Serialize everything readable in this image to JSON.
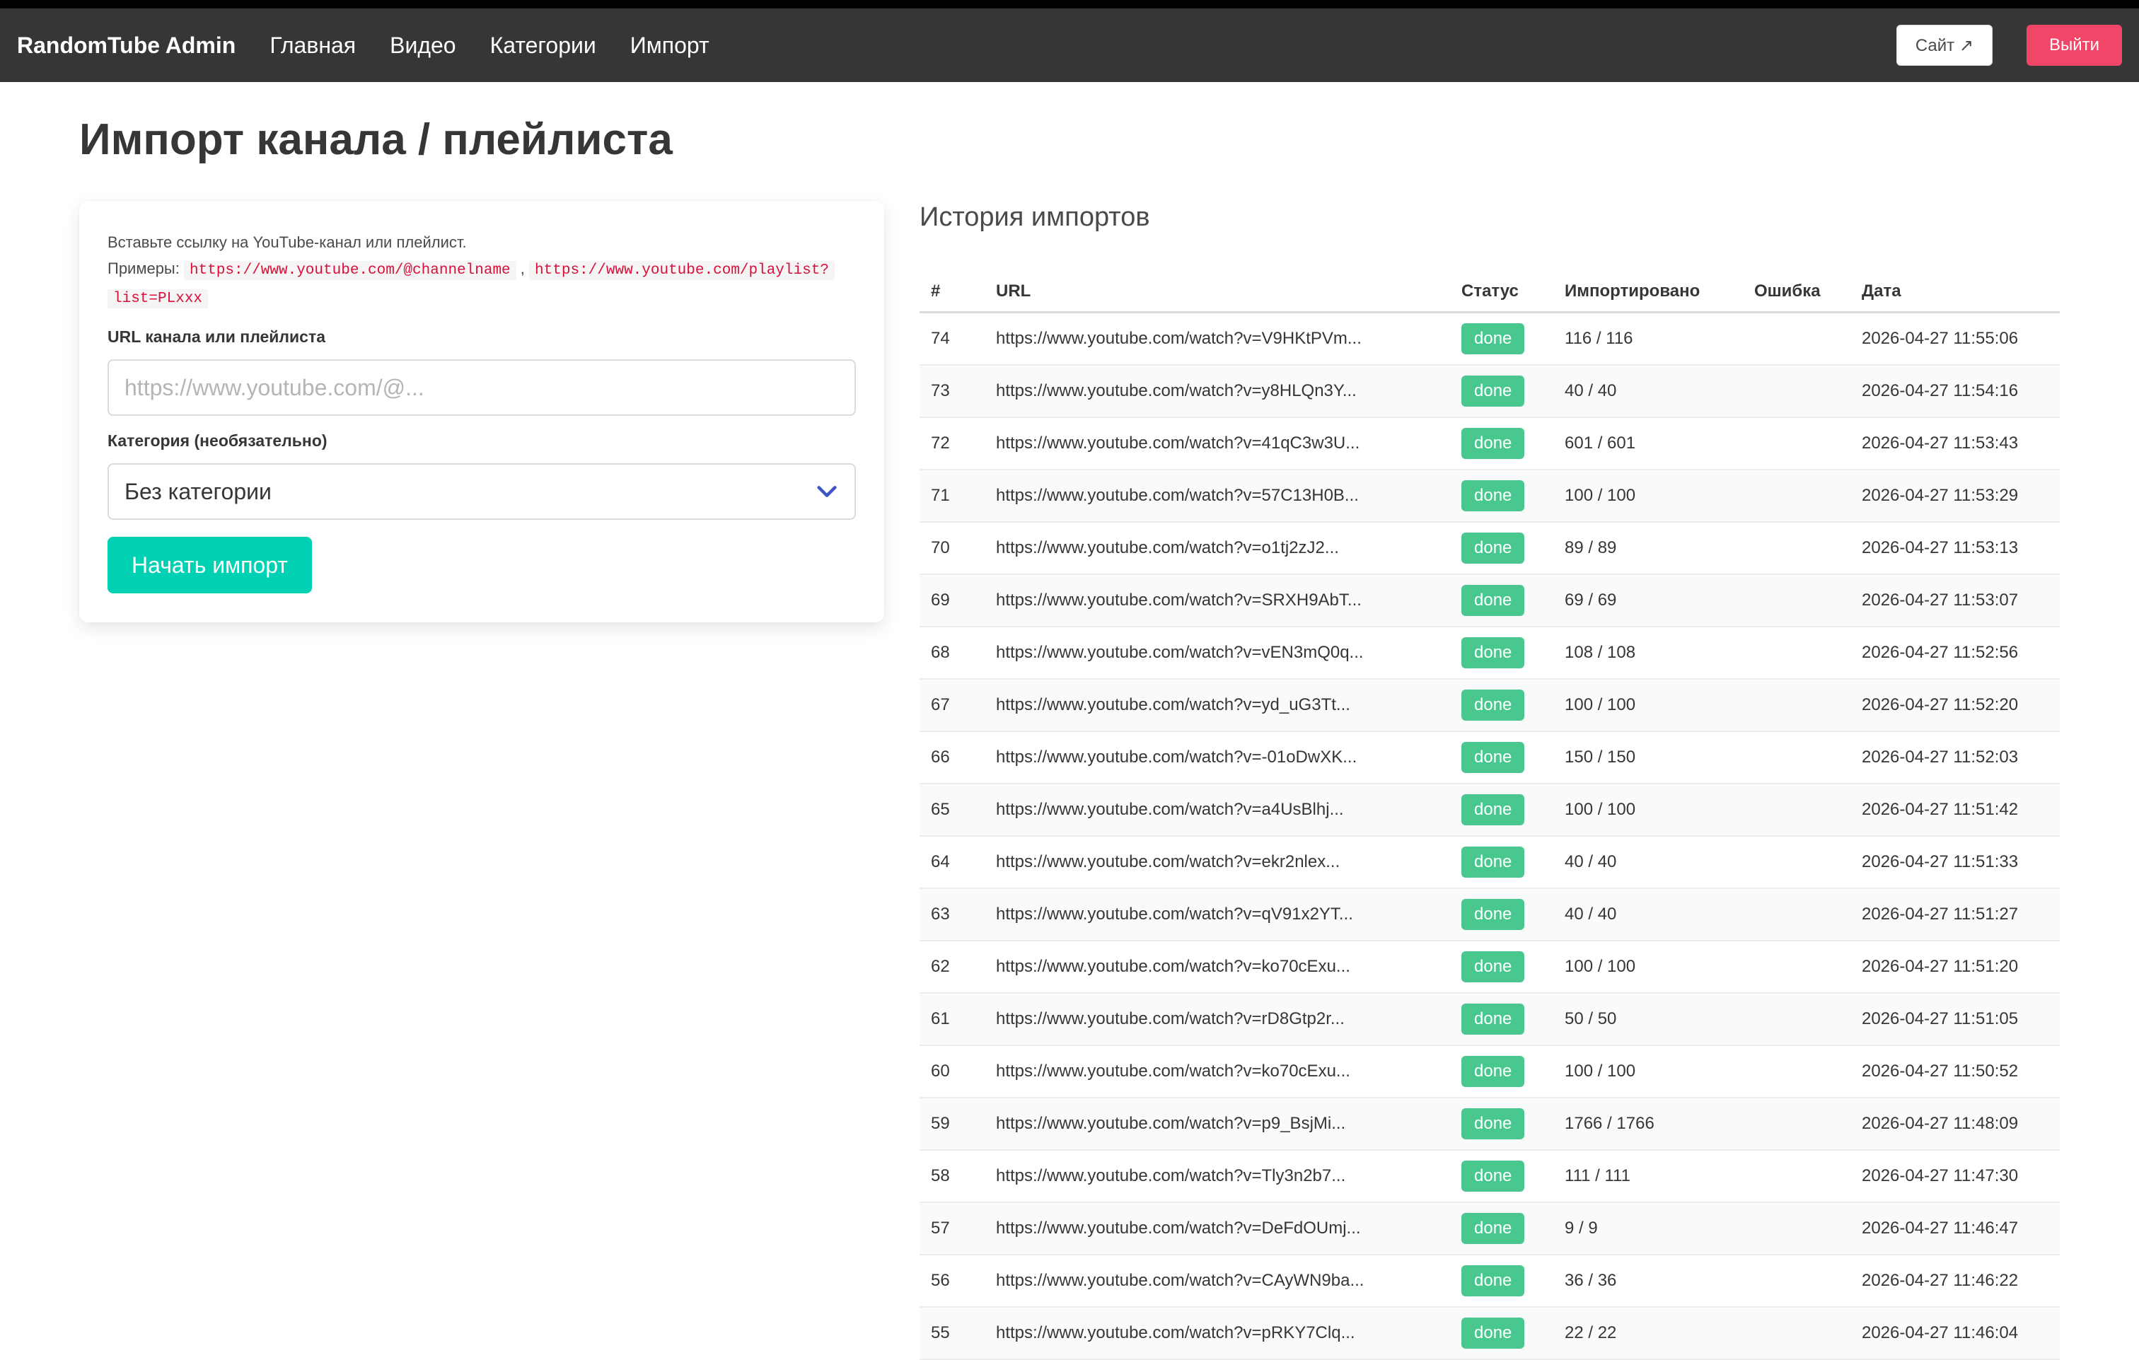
{
  "navbar": {
    "brand": "RandomTube Admin",
    "links": [
      "Главная",
      "Видео",
      "Категории",
      "Импорт"
    ],
    "site_label": "Сайт ↗",
    "logout_label": "Выйти"
  },
  "page": {
    "title": "Импорт канала / плейлиста"
  },
  "form": {
    "help_line1": "Вставьте ссылку на YouTube-канал или плейлист.",
    "examples_label": "Примеры:",
    "example1": "https://www.youtube.com/@channelname",
    "examples_sep": ",",
    "example2_part1": "https://www.youtube.com/playlist?",
    "example2_part2": "list=PLxxx",
    "url_label": "URL канала или плейлиста",
    "url_value": "",
    "url_placeholder": "https://www.youtube.com/@...",
    "category_label": "Категория (необязательно)",
    "category_selected": "Без категории",
    "submit_label": "Начать импорт"
  },
  "history": {
    "title": "История импортов",
    "columns": [
      "#",
      "URL",
      "Статус",
      "Импортировано",
      "Ошибка",
      "Дата"
    ],
    "rows": [
      {
        "id": "74",
        "url": "https://www.youtube.com/watch?v=V9HKtPVm...",
        "status": "done",
        "imported": "116 / 116",
        "error": "",
        "date": "2026-04-27 11:55:06"
      },
      {
        "id": "73",
        "url": "https://www.youtube.com/watch?v=y8HLQn3Y...",
        "status": "done",
        "imported": "40 / 40",
        "error": "",
        "date": "2026-04-27 11:54:16"
      },
      {
        "id": "72",
        "url": "https://www.youtube.com/watch?v=41qC3w3U...",
        "status": "done",
        "imported": "601 / 601",
        "error": "",
        "date": "2026-04-27 11:53:43"
      },
      {
        "id": "71",
        "url": "https://www.youtube.com/watch?v=57C13H0B...",
        "status": "done",
        "imported": "100 / 100",
        "error": "",
        "date": "2026-04-27 11:53:29"
      },
      {
        "id": "70",
        "url": "https://www.youtube.com/watch?v=o1tj2zJ2...",
        "status": "done",
        "imported": "89 / 89",
        "error": "",
        "date": "2026-04-27 11:53:13"
      },
      {
        "id": "69",
        "url": "https://www.youtube.com/watch?v=SRXH9AbT...",
        "status": "done",
        "imported": "69 / 69",
        "error": "",
        "date": "2026-04-27 11:53:07"
      },
      {
        "id": "68",
        "url": "https://www.youtube.com/watch?v=vEN3mQ0q...",
        "status": "done",
        "imported": "108 / 108",
        "error": "",
        "date": "2026-04-27 11:52:56"
      },
      {
        "id": "67",
        "url": "https://www.youtube.com/watch?v=yd_uG3Tt...",
        "status": "done",
        "imported": "100 / 100",
        "error": "",
        "date": "2026-04-27 11:52:20"
      },
      {
        "id": "66",
        "url": "https://www.youtube.com/watch?v=-01oDwXK...",
        "status": "done",
        "imported": "150 / 150",
        "error": "",
        "date": "2026-04-27 11:52:03"
      },
      {
        "id": "65",
        "url": "https://www.youtube.com/watch?v=a4UsBlhj...",
        "status": "done",
        "imported": "100 / 100",
        "error": "",
        "date": "2026-04-27 11:51:42"
      },
      {
        "id": "64",
        "url": "https://www.youtube.com/watch?v=ekr2nlex...",
        "status": "done",
        "imported": "40 / 40",
        "error": "",
        "date": "2026-04-27 11:51:33"
      },
      {
        "id": "63",
        "url": "https://www.youtube.com/watch?v=qV91x2YT...",
        "status": "done",
        "imported": "40 / 40",
        "error": "",
        "date": "2026-04-27 11:51:27"
      },
      {
        "id": "62",
        "url": "https://www.youtube.com/watch?v=ko70cExu...",
        "status": "done",
        "imported": "100 / 100",
        "error": "",
        "date": "2026-04-27 11:51:20"
      },
      {
        "id": "61",
        "url": "https://www.youtube.com/watch?v=rD8Gtp2r...",
        "status": "done",
        "imported": "50 / 50",
        "error": "",
        "date": "2026-04-27 11:51:05"
      },
      {
        "id": "60",
        "url": "https://www.youtube.com/watch?v=ko70cExu...",
        "status": "done",
        "imported": "100 / 100",
        "error": "",
        "date": "2026-04-27 11:50:52"
      },
      {
        "id": "59",
        "url": "https://www.youtube.com/watch?v=p9_BsjMi...",
        "status": "done",
        "imported": "1766 / 1766",
        "error": "",
        "date": "2026-04-27 11:48:09"
      },
      {
        "id": "58",
        "url": "https://www.youtube.com/watch?v=Tly3n2b7...",
        "status": "done",
        "imported": "111 / 111",
        "error": "",
        "date": "2026-04-27 11:47:30"
      },
      {
        "id": "57",
        "url": "https://www.youtube.com/watch?v=DeFdOUmj...",
        "status": "done",
        "imported": "9 / 9",
        "error": "",
        "date": "2026-04-27 11:46:47"
      },
      {
        "id": "56",
        "url": "https://www.youtube.com/watch?v=CAyWN9ba...",
        "status": "done",
        "imported": "36 / 36",
        "error": "",
        "date": "2026-04-27 11:46:22"
      },
      {
        "id": "55",
        "url": "https://www.youtube.com/watch?v=pRKY7Clq...",
        "status": "done",
        "imported": "22 / 22",
        "error": "",
        "date": "2026-04-27 11:46:04"
      }
    ]
  },
  "colors": {
    "navbar_bg": "#363636",
    "primary": "#00d1b2",
    "danger": "#f14668",
    "success": "#48c78e",
    "chevron": "#3e56c4"
  },
  "icons": {
    "select_arrow": "chevron-down-icon"
  }
}
